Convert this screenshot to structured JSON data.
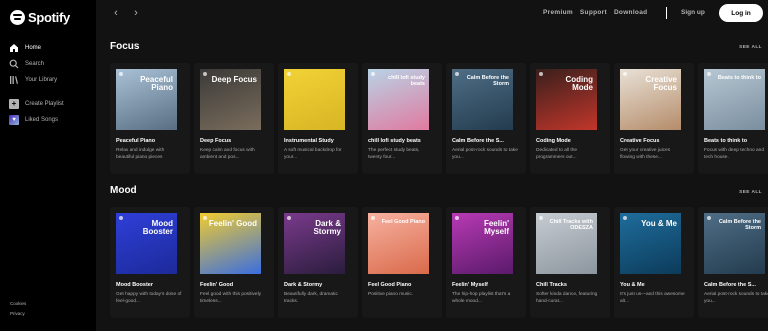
{
  "brand": {
    "name": "Spotify"
  },
  "sidebar": {
    "nav": [
      {
        "label": "Home",
        "icon": "home-icon",
        "active": true
      },
      {
        "label": "Search",
        "icon": "search-icon",
        "active": false
      },
      {
        "label": "Your Library",
        "icon": "library-icon",
        "active": false
      }
    ],
    "actions": [
      {
        "label": "Create Playlist",
        "icon": "plus-icon"
      },
      {
        "label": "Liked Songs",
        "icon": "heart-icon"
      }
    ],
    "legal": [
      "Cookies",
      "Privacy"
    ]
  },
  "topbar": {
    "links": [
      "Premium",
      "Support",
      "Download"
    ],
    "signup": "Sign up",
    "login": "Log in"
  },
  "sections": [
    {
      "title": "Focus",
      "see_all": "SEE ALL",
      "cards": [
        {
          "title": "Peaceful Piano",
          "desc": "Relax and indulge with beautiful piano pieces",
          "cover_text": "Peaceful Piano",
          "colors": [
            "#a9c1d6",
            "#596e83"
          ]
        },
        {
          "title": "Deep Focus",
          "desc": "Keep calm and focus with ambient and pos...",
          "cover_text": "Deep Focus",
          "colors": [
            "#3b3a38",
            "#7a6d5c"
          ]
        },
        {
          "title": "Instrumental Study",
          "desc": "A soft musical backdrop for your...",
          "cover_text": "",
          "colors": [
            "#f1d236",
            "#d8b524"
          ]
        },
        {
          "title": "chill lofi study beats",
          "desc": "The perfect study beats, twenty four...",
          "cover_text": "chill lofi study beats",
          "colors": [
            "#b8d3e6",
            "#e07aa0"
          ]
        },
        {
          "title": "Calm Before the S...",
          "desc": "Aerial post-rock sounds to take you...",
          "cover_text": "Calm Before the Storm",
          "colors": [
            "#4f6e86",
            "#233b4e"
          ]
        },
        {
          "title": "Coding Mode",
          "desc": "Dedicated to all the programmers out...",
          "cover_text": "Coding Mode",
          "colors": [
            "#3a1f1c",
            "#c2362b"
          ]
        },
        {
          "title": "Creative Focus",
          "desc": "Get your creative juices flowing with these...",
          "cover_text": "Creative Focus",
          "colors": [
            "#e8e1d6",
            "#b58c6a"
          ]
        },
        {
          "title": "Beats to think to",
          "desc": "Focus with deep techno and tech house.",
          "cover_text": "Beats to think to",
          "colors": [
            "#b7c7d3",
            "#7a8e9e"
          ]
        }
      ]
    },
    {
      "title": "Mood",
      "see_all": "SEE ALL",
      "cards": [
        {
          "title": "Mood Booster",
          "desc": "Get happy with today's dose of feel-good...",
          "cover_text": "Mood Booster",
          "colors": [
            "#2f3fd8",
            "#1c2a9a"
          ]
        },
        {
          "title": "Feelin' Good",
          "desc": "Feel good with this positively timeless...",
          "cover_text": "Feelin' Good",
          "colors": [
            "#f2cc2e",
            "#3a6ee0"
          ]
        },
        {
          "title": "Dark & Stormy",
          "desc": "Beautifully dark, dramatic tracks.",
          "cover_text": "Dark & Stormy",
          "colors": [
            "#7a3a8c",
            "#2a1d3d"
          ]
        },
        {
          "title": "Feel Good Piano",
          "desc": "Positive piano music.",
          "cover_text": "Feel Good Piano",
          "colors": [
            "#f7b1a0",
            "#d96a4a"
          ]
        },
        {
          "title": "Feelin' Myself",
          "desc": "The hip-hop playlist that's a whole mood...",
          "cover_text": "Feelin' Myself",
          "colors": [
            "#b83ab4",
            "#5a1a6a"
          ]
        },
        {
          "title": "Chill Tracks",
          "desc": "Softer kinda dance, featuring hand-curat...",
          "cover_text": "Chill Tracks with ODESZA",
          "colors": [
            "#c6ccd2",
            "#8c959e"
          ]
        },
        {
          "title": "You & Me",
          "desc": "It's just us—and this awesome alt...",
          "cover_text": "You & Me",
          "colors": [
            "#1f6d9c",
            "#0c3b5a"
          ]
        },
        {
          "title": "Calm Before the S...",
          "desc": "Aerial post-rock sounds to take you...",
          "cover_text": "Calm Before the Storm",
          "colors": [
            "#4f6e86",
            "#233b4e"
          ]
        }
      ]
    }
  ]
}
